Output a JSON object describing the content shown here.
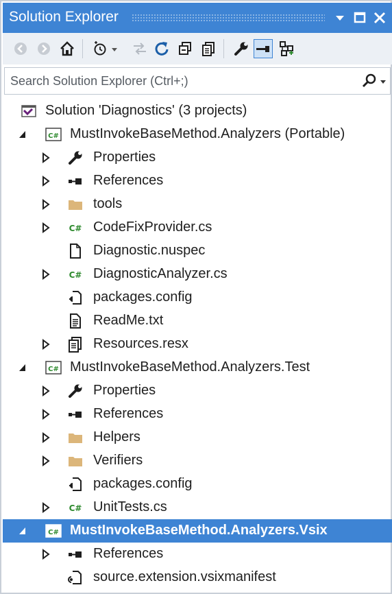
{
  "window": {
    "title": "Solution Explorer"
  },
  "search": {
    "placeholder": "Search Solution Explorer (Ctrl+;)"
  },
  "tree": {
    "solution": "Solution 'Diagnostics' (3 projects)",
    "p1": {
      "name": "MustInvokeBaseMethod.Analyzers (Portable)",
      "items": [
        "Properties",
        "References",
        "tools",
        "CodeFixProvider.cs",
        "Diagnostic.nuspec",
        "DiagnosticAnalyzer.cs",
        "packages.config",
        "ReadMe.txt",
        "Resources.resx"
      ]
    },
    "p2": {
      "name": "MustInvokeBaseMethod.Analyzers.Test",
      "items": [
        "Properties",
        "References",
        "Helpers",
        "Verifiers",
        "packages.config",
        "UnitTests.cs"
      ]
    },
    "p3": {
      "name": "MustInvokeBaseMethod.Analyzers.Vsix",
      "items": [
        "References",
        "source.extension.vsixmanifest"
      ]
    }
  },
  "colors": {
    "accent": "#3e84d4",
    "csharp": "#2e8a2e",
    "folder": "#dcb67a"
  }
}
